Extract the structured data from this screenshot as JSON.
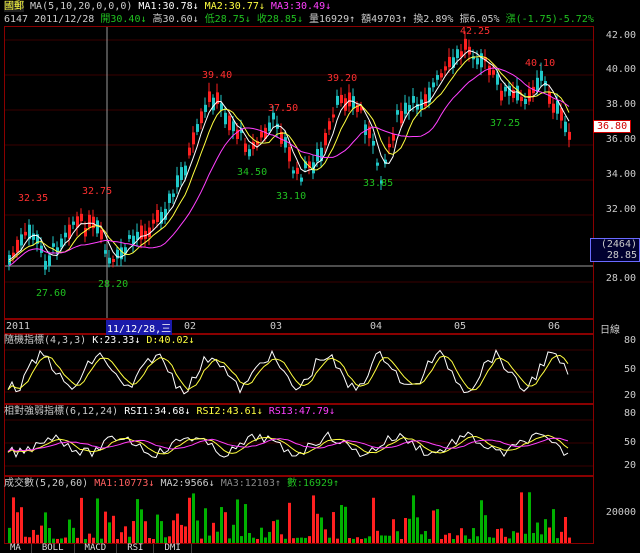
{
  "header": {
    "name": "國郵",
    "ma_spec": "MA(5,10,20,0,0,0)",
    "ma1": "MA1:30.78↓",
    "ma2": "MA2:30.77↓",
    "ma3": "MA3:30.49↓",
    "code": "6147",
    "date": "2011/12/28",
    "open": "開30.40↓",
    "high": "高30.60↓",
    "low": "低28.75↓",
    "close": "收28.85↓",
    "volume": "量16929↑",
    "amount": "額49703↑",
    "turnover": "換2.89%",
    "amplitude": "振6.05%",
    "change": "漲(-1.75)-5.72%"
  },
  "price_axis": [
    "42.00",
    "40.00",
    "38.00",
    "36.00",
    "34.00",
    "32.00",
    "28.00"
  ],
  "last_price": "36.80",
  "crosshair_box": [
    "(2464)",
    "28.85"
  ],
  "annotations": [
    {
      "text": "42.25",
      "color": "#ff3030"
    },
    {
      "text": "40.10",
      "color": "#ff3030"
    },
    {
      "text": "39.40",
      "color": "#ff3030"
    },
    {
      "text": "39.20",
      "color": "#ff3030"
    },
    {
      "text": "37.50",
      "color": "#ff3030"
    },
    {
      "text": "37.25",
      "color": "#20c020"
    },
    {
      "text": "34.50",
      "color": "#20c020"
    },
    {
      "text": "33.85",
      "color": "#20c020"
    },
    {
      "text": "33.10",
      "color": "#20c020"
    },
    {
      "text": "32.75",
      "color": "#ff3030"
    },
    {
      "text": "32.35",
      "color": "#ff3030"
    },
    {
      "text": "28.20",
      "color": "#20c020"
    },
    {
      "text": "27.60",
      "color": "#20c020"
    }
  ],
  "time_axis": {
    "labels": [
      "2011",
      "11/12/28,三",
      "02",
      "03",
      "04",
      "05",
      "06"
    ],
    "unit": "日線"
  },
  "kd": {
    "title": "隨機指標(4,3,3)",
    "k": "K:23.33↓",
    "d": "D:40.02↓",
    "axis": [
      "80",
      "50",
      "20"
    ]
  },
  "rsi": {
    "title": "相對強弱指標(6,12,24)",
    "rsi1": "RSI1:34.68↓",
    "rsi2": "RSI2:43.61↓",
    "rsi3": "RSI3:47.79↓",
    "axis": [
      "80",
      "50",
      "20"
    ]
  },
  "vol": {
    "title": "成交數(5,20,60)",
    "ma1": "MA1:10773↓",
    "ma2": "MA2:9566↓",
    "ma3": "MA3:12103↑",
    "count": "數:16929↑",
    "axis": [
      "20000"
    ]
  },
  "tabs": [
    "MA",
    "BOLL",
    "MACD",
    "RSI",
    "DMI"
  ],
  "colors": {
    "up": "#ff2020",
    "down": "#20c8c8",
    "down_green": "#00b000",
    "ma1": "#ffffff",
    "ma2": "#ffff40",
    "ma3": "#ff40ff",
    "frame": "#8a0000"
  }
}
